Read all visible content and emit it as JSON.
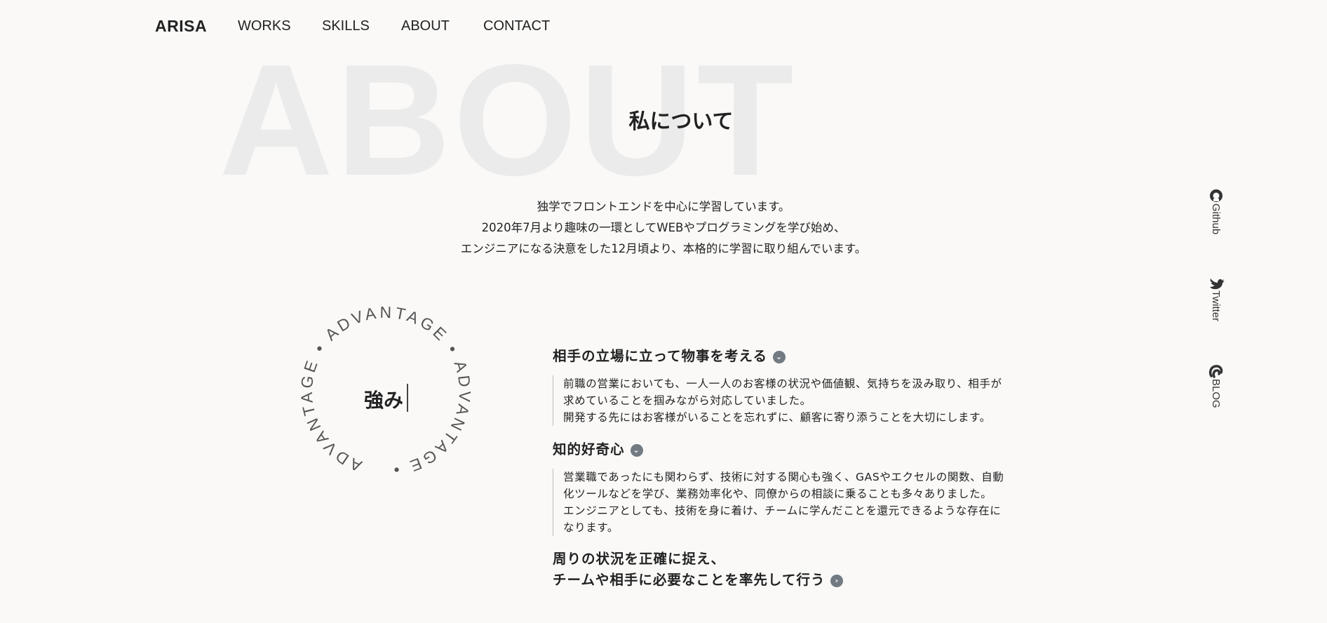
{
  "nav": {
    "logo": "ARISA",
    "links": [
      "WORKS",
      "SKILLS",
      "ABOUT",
      "CONTACT"
    ]
  },
  "about": {
    "background_word": "ABOUT",
    "title": "私について",
    "intro": [
      "独学でフロントエンドを中心に学習しています。",
      "2020年7月より趣味の一環としてWEBやプログラミングを学び始め、",
      "エンジニアになる決意をした12月頃より、本格的に学習に取り組んでいます。"
    ]
  },
  "strengths": {
    "circle_text": "ADVANTAGE • ADVANTAGE • ADVANTAGE •",
    "label": "強み",
    "items": [
      {
        "title": "相手の立場に立って物事を考える",
        "expanded": true,
        "body": [
          "前職の営業においても、一人一人のお客様の状況や価値観、気持ちを汲み取り、相手が",
          "求めていることを掴みながら対応していました。",
          "開発する先にはお客様がいることを忘れずに、顧客に寄り添うことを大切にします。"
        ]
      },
      {
        "title": "知的好奇心",
        "expanded": true,
        "body": [
          "営業職であったにも関わらず、技術に対する関心も強く、GASやエクセルの関数、自動",
          "化ツールなどを学び、業務効率化や、同僚からの相談に乗ることも多々ありました。",
          "エンジニアとしても、技術を身に着け、チームに学んだことを還元できるような存在に",
          "なります。"
        ]
      },
      {
        "title_lines": [
          "周りの状況を正確に捉え、",
          "チームや相手に必要なことを率先して行う"
        ],
        "expanded": false
      }
    ]
  },
  "social": [
    {
      "label": "Github",
      "icon": "github-icon"
    },
    {
      "label": "Twitter",
      "icon": "twitter-bird-icon"
    },
    {
      "label": "BLOG",
      "icon": "blog-icon"
    }
  ],
  "colors": {
    "background": "#faf9f8",
    "text": "#222222",
    "watermark": "#ebebeb",
    "chevron": "#727a82"
  }
}
